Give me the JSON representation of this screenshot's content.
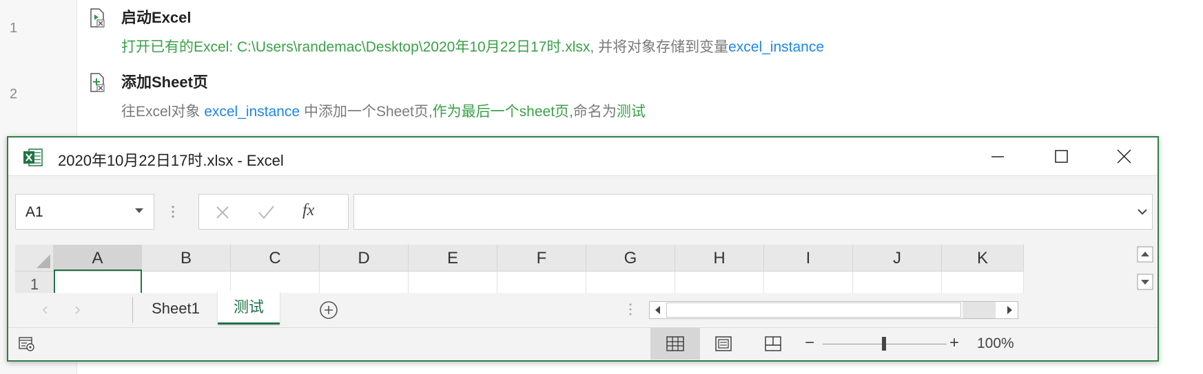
{
  "steps": [
    {
      "line": "1",
      "title": "启动Excel",
      "desc_parts": [
        {
          "t": "打开已有的Excel: C:\\Users\\randemac\\Desktop\\2020年10月22日17时.xlsx",
          "c": "g"
        },
        {
          "t": ", 并将对象存储到变量",
          "c": "n"
        },
        {
          "t": "excel_instance",
          "c": "b"
        }
      ]
    },
    {
      "line": "2",
      "title": "添加Sheet页",
      "desc_parts": [
        {
          "t": "往Excel对象 ",
          "c": "n"
        },
        {
          "t": "excel_instance",
          "c": "b"
        },
        {
          "t": " 中添加一个Sheet页,",
          "c": "n"
        },
        {
          "t": "作为最后一个sheet页",
          "c": "g"
        },
        {
          "t": ",命名为",
          "c": "n"
        },
        {
          "t": "测试",
          "c": "g"
        }
      ]
    }
  ],
  "excel": {
    "window_title": "2020年10月22日17时.xlsx - Excel",
    "name_box": "A1",
    "fx_label": "fx",
    "formula_value": "",
    "columns": [
      "A",
      "B",
      "C",
      "D",
      "E",
      "F",
      "G",
      "H",
      "I",
      "J",
      "K"
    ],
    "rows": [
      "1"
    ],
    "sheets": [
      {
        "label": "Sheet1",
        "active": false
      },
      {
        "label": "测试",
        "active": true
      }
    ],
    "zoom": "100%",
    "zoom_minus": "−",
    "zoom_plus": "+"
  },
  "colors": {
    "accent_green": "#2e7d46",
    "text_green": "#3aa047",
    "text_blue": "#1e86e8"
  }
}
